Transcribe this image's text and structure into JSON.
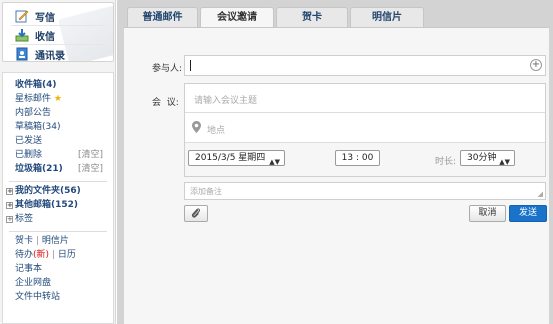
{
  "sidebar": {
    "actions": [
      {
        "label": "写信",
        "icon": "compose-icon"
      },
      {
        "label": "收信",
        "icon": "inbox-download-icon"
      },
      {
        "label": "通讯录",
        "icon": "contacts-icon"
      }
    ],
    "folders": [
      {
        "label": "收件箱",
        "count": "(4)"
      },
      {
        "label": "星标邮件",
        "icon": "star-icon"
      },
      {
        "label": "内部公告"
      },
      {
        "label": "草稿箱",
        "count": "(34)"
      },
      {
        "label": "已发送"
      },
      {
        "label": "已删除",
        "extra": "[清空]"
      },
      {
        "label": "垃圾箱",
        "count": "(21)",
        "extra": "[清空]"
      }
    ],
    "groups": [
      {
        "label": "我的文件夹",
        "count": "(56)"
      },
      {
        "label": "其他邮箱",
        "count": "(152)"
      },
      {
        "label": "标签"
      }
    ],
    "apps": {
      "greeting": "贺卡",
      "divider": "|",
      "postcard": "明信片",
      "todo": "待办",
      "todo_badge": "(新)",
      "calendar": "日历",
      "notes": "记事本",
      "netdisk": "企业网盘",
      "transfer": "文件中转站"
    }
  },
  "tabs": [
    {
      "label": "普通邮件",
      "active": false
    },
    {
      "label": "会议邀请",
      "active": true
    },
    {
      "label": "贺卡",
      "active": false
    },
    {
      "label": "明信片",
      "active": false
    }
  ],
  "form": {
    "participants_label": "参与人:",
    "meeting_label": "会  议:",
    "subject_placeholder": "请输入会议主题",
    "location_placeholder": "地点",
    "date_value": "2015/3/5 星期四",
    "time_value": "13 : 00",
    "duration_label": "时长:",
    "duration_value": "30分钟",
    "notes_placeholder": "添加备注",
    "cancel_label": "取消",
    "send_label": "发送"
  },
  "colors": {
    "accent": "#1a73c8",
    "link": "#234a7c"
  }
}
